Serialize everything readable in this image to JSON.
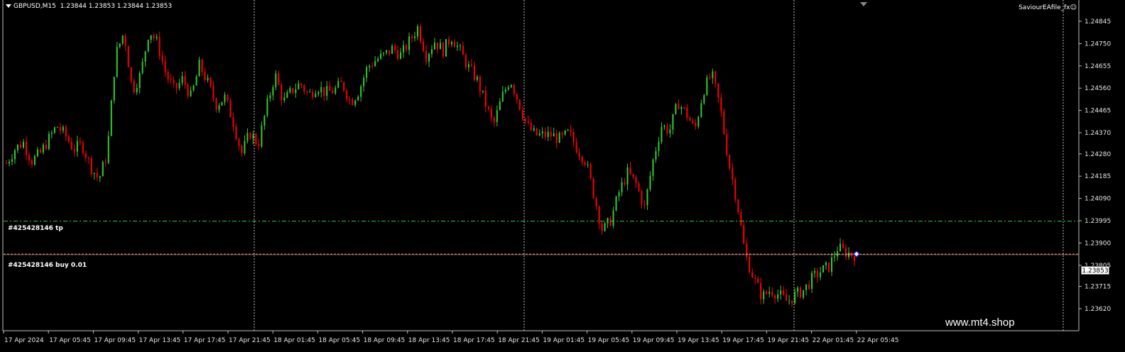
{
  "header": {
    "symbol": "GBPUSD,M15",
    "ohlc": "1.23844 1.23853 1.23844 1.23853",
    "ea_name": "SaviourEAfile_fx",
    "ea_icon": "smiley-icon"
  },
  "watermark": "www.mt4.shop",
  "orders": {
    "tp_label": "#425428146 tp",
    "tp_price": 1.23993,
    "buy_label": "#425428146 buy 0.01",
    "buy_price": 1.23853
  },
  "current_price": "1.23853",
  "colors": {
    "bull": "#32cd32",
    "bear": "#ff0000",
    "tp_line": "#32cd32",
    "entry_line": "#ff7f50",
    "grid": "#c0c0c0",
    "background": "#000000"
  },
  "chart_data": {
    "type": "candlestick",
    "title": "GBPUSD,M15",
    "ylim": [
      1.2358,
      1.249
    ],
    "y_ticks": [
      "1.24845",
      "1.24750",
      "1.24655",
      "1.24560",
      "1.24465",
      "1.24370",
      "1.24280",
      "1.24185",
      "1.24090",
      "1.23995",
      "1.23900",
      "1.23805",
      "1.23715",
      "1.23620"
    ],
    "x_ticks": [
      "17 Apr 2024",
      "17 Apr 05:45",
      "17 Apr 09:45",
      "17 Apr 13:45",
      "17 Apr 17:45",
      "17 Apr 21:45",
      "18 Apr 01:45",
      "18 Apr 05:45",
      "18 Apr 09:45",
      "18 Apr 13:45",
      "18 Apr 17:45",
      "18 Apr 21:45",
      "19 Apr 01:45",
      "19 Apr 05:45",
      "19 Apr 09:45",
      "19 Apr 13:45",
      "19 Apr 17:45",
      "19 Apr 21:45",
      "22 Apr 01:45",
      "22 Apr 05:45"
    ],
    "grid": "vertical day separators",
    "close_path": [
      1.2424,
      1.243,
      1.2433,
      1.2425,
      1.2428,
      1.2434,
      1.244,
      1.2436,
      1.243,
      1.2432,
      1.2423,
      1.2417,
      1.2428,
      1.247,
      1.248,
      1.2455,
      1.2462,
      1.2481,
      1.2475,
      1.2462,
      1.2455,
      1.246,
      1.2452,
      1.2466,
      1.2458,
      1.2449,
      1.2452,
      1.2442,
      1.2428,
      1.2437,
      1.2432,
      1.2448,
      1.2462,
      1.245,
      1.2455,
      1.2458,
      1.2453,
      1.2457,
      1.2454,
      1.2455,
      1.2458,
      1.245,
      1.2455,
      1.2465,
      1.2468,
      1.247,
      1.2473,
      1.247,
      1.2476,
      1.2482,
      1.247,
      1.2476,
      1.2472,
      1.2478,
      1.2472,
      1.2465,
      1.246,
      1.245,
      1.244,
      1.2452,
      1.246,
      1.245,
      1.244,
      1.2436,
      1.2436,
      1.2436,
      1.2434,
      1.2437,
      1.243,
      1.2425,
      1.241,
      1.2395,
      1.24,
      1.2412,
      1.242,
      1.2415,
      1.2405,
      1.2425,
      1.244,
      1.2438,
      1.245,
      1.2445,
      1.2438,
      1.2455,
      1.2462,
      1.2448,
      1.2425,
      1.2408,
      1.2385,
      1.2375,
      1.2367,
      1.237,
      1.2368,
      1.2365,
      1.2368,
      1.237,
      1.2375,
      1.2378,
      1.238,
      1.2388,
      1.2386,
      1.2385
    ]
  }
}
